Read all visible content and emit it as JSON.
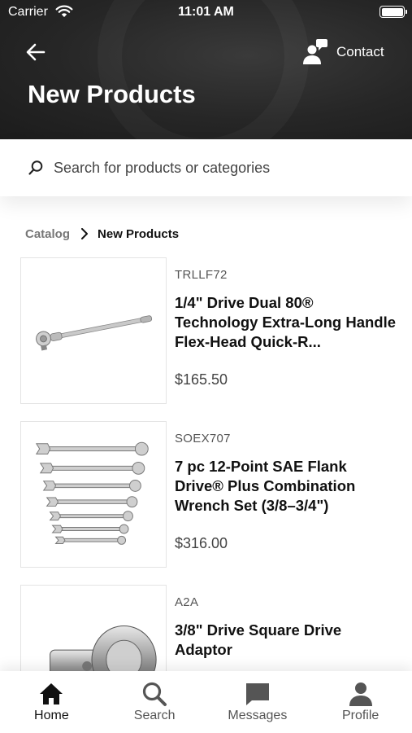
{
  "status_bar": {
    "carrier": "Carrier",
    "time": "11:01 AM"
  },
  "header": {
    "title": "New Products",
    "contact_label": "Contact"
  },
  "search": {
    "placeholder": "Search for products or categories"
  },
  "breadcrumb": {
    "root": "Catalog",
    "current": "New Products"
  },
  "products": [
    {
      "sku": "TRLLF72",
      "name": "1/4\" Drive Dual 80® Technology Extra-Long Handle Flex-Head Quick-R...",
      "price": "$165.50",
      "image": "ratchet-image"
    },
    {
      "sku": "SOEX707",
      "name": "7 pc 12-Point SAE Flank Drive® Plus Combination Wrench Set (3/8–3/4\")",
      "price": "$316.00",
      "image": "wrench-set-image"
    },
    {
      "sku": "A2A",
      "name": "3/8\" Drive Square Drive Adaptor",
      "price": "",
      "image": "adaptor-image"
    }
  ],
  "tabs": [
    {
      "label": "Home",
      "icon": "home-icon",
      "active": true
    },
    {
      "label": "Search",
      "icon": "search-icon",
      "active": false
    },
    {
      "label": "Messages",
      "icon": "messages-icon",
      "active": false
    },
    {
      "label": "Profile",
      "icon": "profile-icon",
      "active": false
    }
  ],
  "colors": {
    "header_bg": "#262626",
    "active_tab": "#111111",
    "inactive_tab": "#555555"
  }
}
